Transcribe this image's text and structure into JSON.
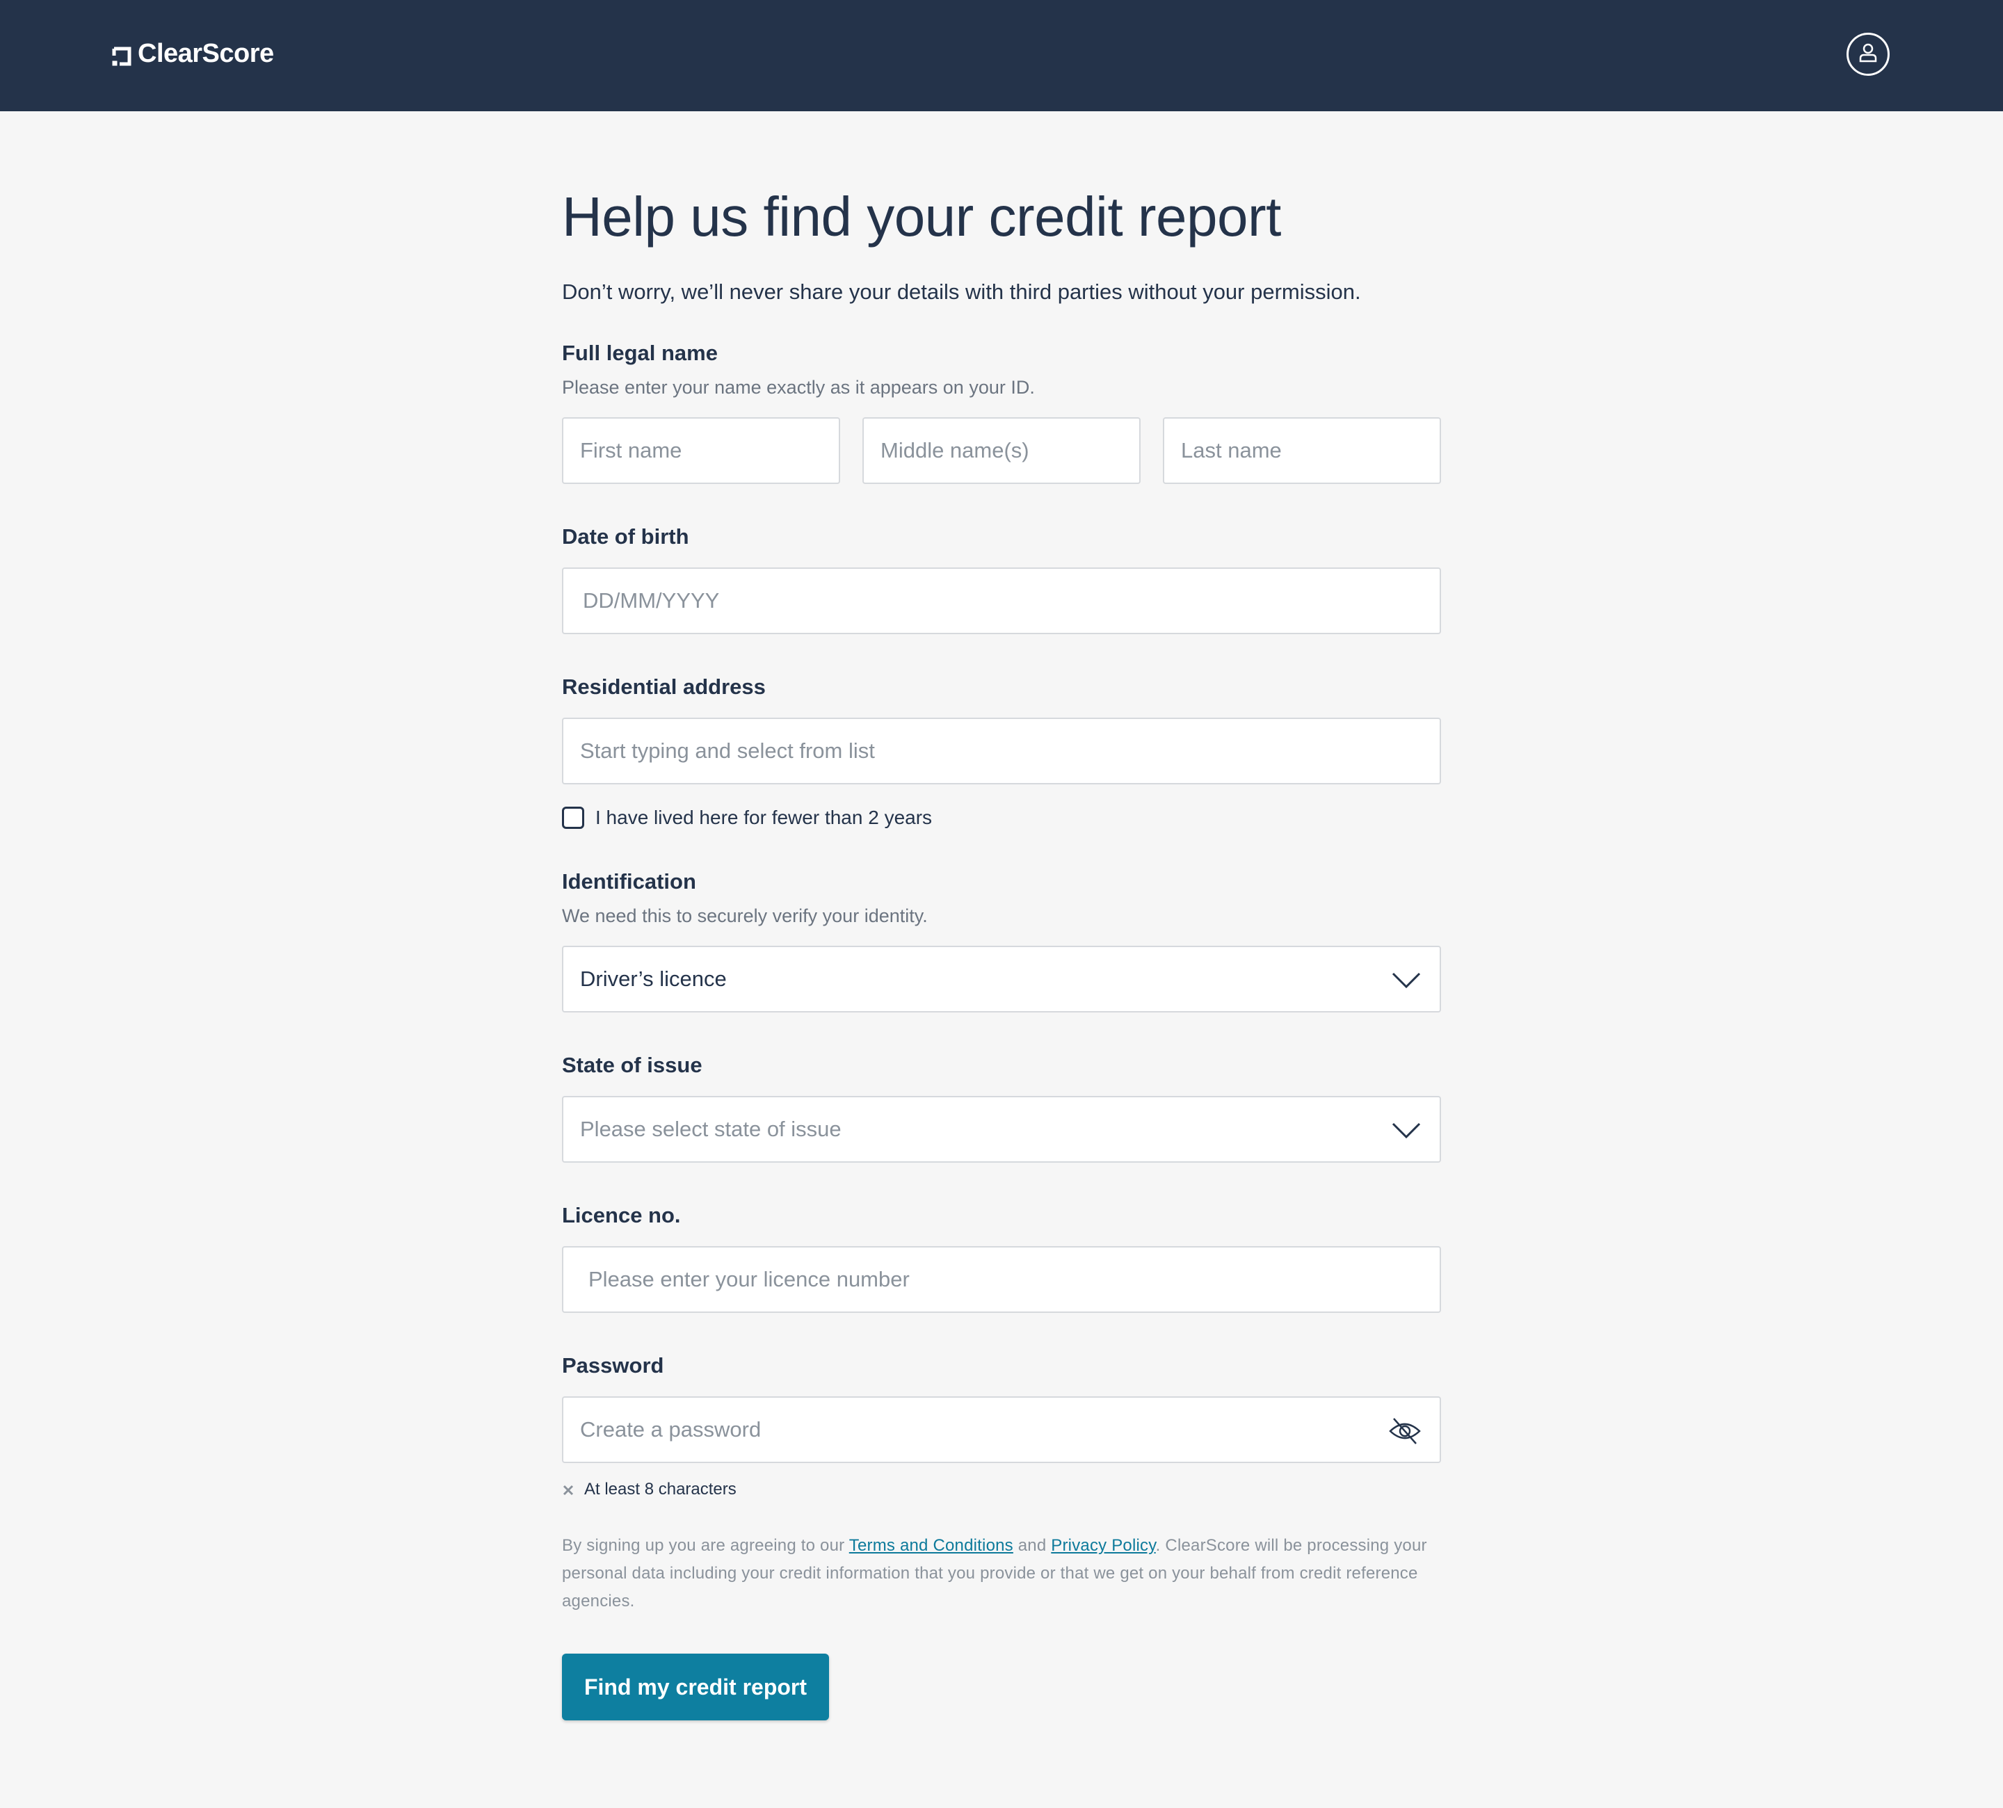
{
  "header": {
    "brand": "ClearScore",
    "logo_icon": "clearscore-mark-icon",
    "account_icon": "user-icon"
  },
  "page": {
    "title": "Help us find your credit report",
    "subtitle": "Don’t worry, we’ll never share your details with third parties without your permission."
  },
  "form": {
    "full_name": {
      "label": "Full legal name",
      "help": "Please enter your name exactly as it appears on your ID.",
      "first_placeholder": "First name",
      "middle_placeholder": "Middle name(s)",
      "last_placeholder": "Last name"
    },
    "dob": {
      "label": "Date of birth",
      "placeholder": "DD/MM/YYYY"
    },
    "address": {
      "label": "Residential address",
      "placeholder": "Start typing and select from list",
      "checkbox_label": "I have lived here for fewer than 2 years",
      "checkbox_checked": false
    },
    "identification": {
      "label": "Identification",
      "help": "We need this to securely verify your identity.",
      "selected": "Driver’s licence"
    },
    "state": {
      "label": "State of issue",
      "placeholder": "Please select state of issue"
    },
    "licence": {
      "label": "Licence no.",
      "placeholder": "Please enter your licence number"
    },
    "password": {
      "label": "Password",
      "placeholder": "Create a password",
      "toggle_icon": "eye-off-icon",
      "requirement": "At least 8 characters",
      "requirement_met": false
    }
  },
  "legal": {
    "prefix": "By signing up you are agreeing to our ",
    "terms_link": "Terms and Conditions",
    "and": " and ",
    "privacy_link": "Privacy Policy",
    "suffix": ". ClearScore will be processing your personal data including your credit information that you provide or that we get on your behalf from credit reference agencies."
  },
  "cta": {
    "label": "Find my credit report"
  },
  "colors": {
    "header_bg": "#24334a",
    "page_bg": "#f6f6f6",
    "primary_button": "#0e7fa0",
    "link": "#0d7a9b"
  }
}
